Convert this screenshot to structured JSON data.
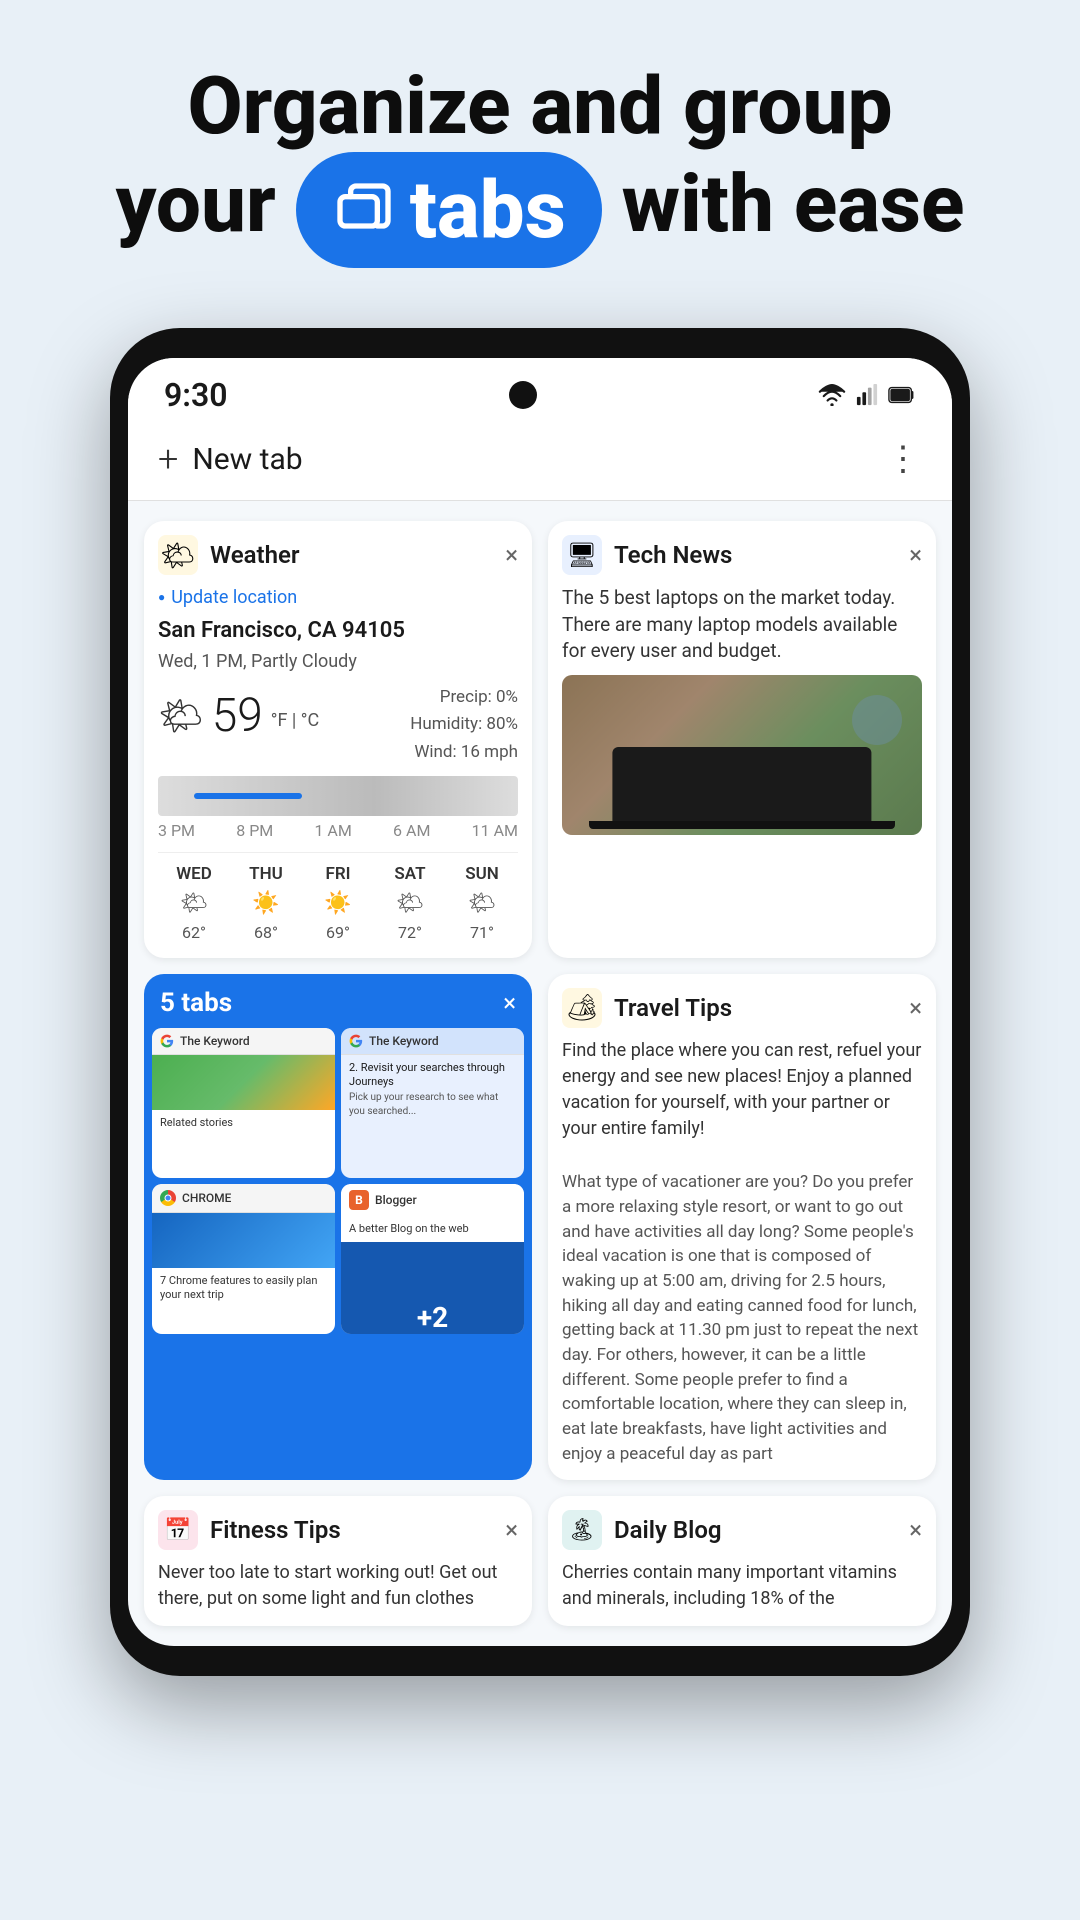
{
  "hero": {
    "line1": "Organize and group",
    "line2_prefix": "your",
    "badge": {
      "icon_label": "tabs-icon",
      "text": "tabs"
    },
    "line2_suffix": "with ease"
  },
  "status_bar": {
    "time": "9:30",
    "wifi": true,
    "signal": true,
    "battery": true
  },
  "chrome_header": {
    "new_tab_label": "New tab",
    "more_label": "⋮"
  },
  "weather_card": {
    "title": "Weather",
    "close": "×",
    "update_label": "Update location",
    "location": "San Francisco, CA 94105",
    "time_desc": "Wed, 1 PM, Partly Cloudy",
    "temperature": "59",
    "unit": "°F",
    "unit_alt": "°C",
    "precip": "Precip: 0%",
    "humidity": "Humidity: 80%",
    "wind": "Wind: 16 mph",
    "times": [
      "3 PM",
      "8 PM",
      "1 AM",
      "6 AM",
      "11 AM"
    ],
    "forecast": [
      {
        "day": "WED",
        "emoji": "🌤",
        "temp": "62°"
      },
      {
        "day": "THU",
        "emoji": "☀",
        "temp": "68°"
      },
      {
        "day": "FRI",
        "emoji": "☀",
        "temp": "69°"
      },
      {
        "day": "SAT",
        "emoji": "🌤",
        "temp": "72°"
      },
      {
        "day": "SUN",
        "emoji": "🌤",
        "temp": "71°"
      }
    ]
  },
  "tech_news_card": {
    "title": "Tech News",
    "close": "×",
    "text": "The 5 best laptops on the market today. There are many laptop models available for every user and budget."
  },
  "five_tabs_card": {
    "title": "5 tabs",
    "close": "×",
    "mini_tabs": [
      {
        "type": "google",
        "title": "The Keyword",
        "content": "Related stories"
      },
      {
        "type": "google",
        "title": "The Keyword",
        "content": "2. Revisit your searches through Journeys"
      },
      {
        "type": "chrome",
        "title": "CHROME",
        "content": "7 Chrome features to easily plan your next trip"
      },
      {
        "type": "blogger",
        "title": "Blogger",
        "content": "A better Blog on the web"
      }
    ],
    "extra_count": "+2"
  },
  "travel_tips_card": {
    "title": "Travel Tips",
    "close": "×",
    "text": "Find the place where you can rest, refuel your energy and see new places! Enjoy a planned vacation for yourself, with your partner or your entire family!\n\nWhat type of vacationer are you? Do you prefer a more relaxing style resort, or want to go out and have activities all day long? Some people's ideal vacation is one that is composed of waking up at 5:00 am, driving for 2.5 hours, hiking all day and eating canned food for lunch, getting back at 11.30 pm just to repeat the next day. For others, however, it can be a little different. Some people prefer to find a comfortable location, where they can sleep in, eat late breakfasts, have light activities and enjoy a peaceful day as part"
  },
  "fitness_tips_card": {
    "title": "Fitness Tips",
    "close": "×",
    "text": "Never too late to start working out! Get out there, put on some light and fun clothes"
  },
  "daily_blog_card": {
    "title": "Daily Blog",
    "close": "×",
    "text": "Cherries contain many important vitamins and minerals, including 18% of the"
  }
}
